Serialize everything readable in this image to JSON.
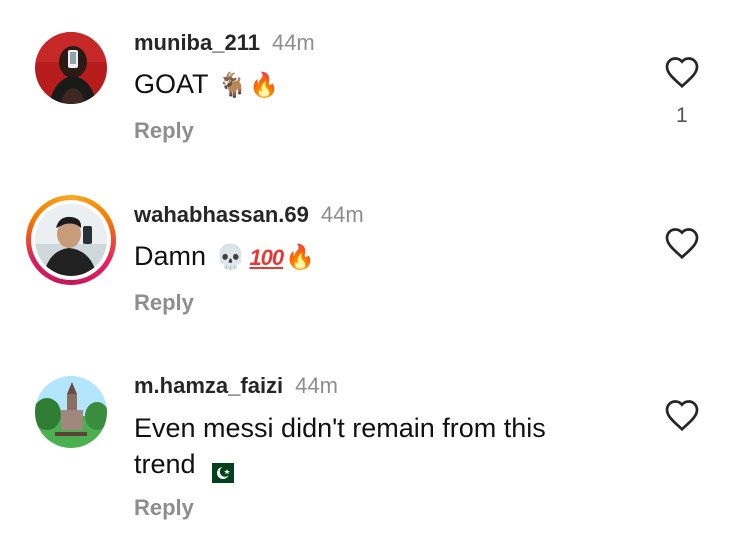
{
  "comments": [
    {
      "username": "muniba_211",
      "time": "44m",
      "text": "GOAT",
      "emojis": [
        "goat-emoji",
        "fire-emoji"
      ],
      "reply_label": "Reply",
      "likes": "1",
      "story_ring": false
    },
    {
      "username": "wahabhassan.69",
      "time": "44m",
      "text": "Damn",
      "emojis": [
        "skull-emoji",
        "hundred-points-emoji",
        "fire-emoji"
      ],
      "hundred": "100",
      "reply_label": "Reply",
      "likes": "",
      "story_ring": true
    },
    {
      "username": "m.hamza_faizi",
      "time": "44m",
      "text": "Even messi didn't remain from this trend",
      "emojis": [
        "pakistan-flag-emoji"
      ],
      "reply_label": "Reply",
      "likes": "",
      "story_ring": false
    }
  ],
  "colors": {
    "username": "#262626",
    "timestamp": "#8e8e8e",
    "reply": "#8e8e8e",
    "ring_start": "#f9a825",
    "ring_end": "#e91e63"
  }
}
